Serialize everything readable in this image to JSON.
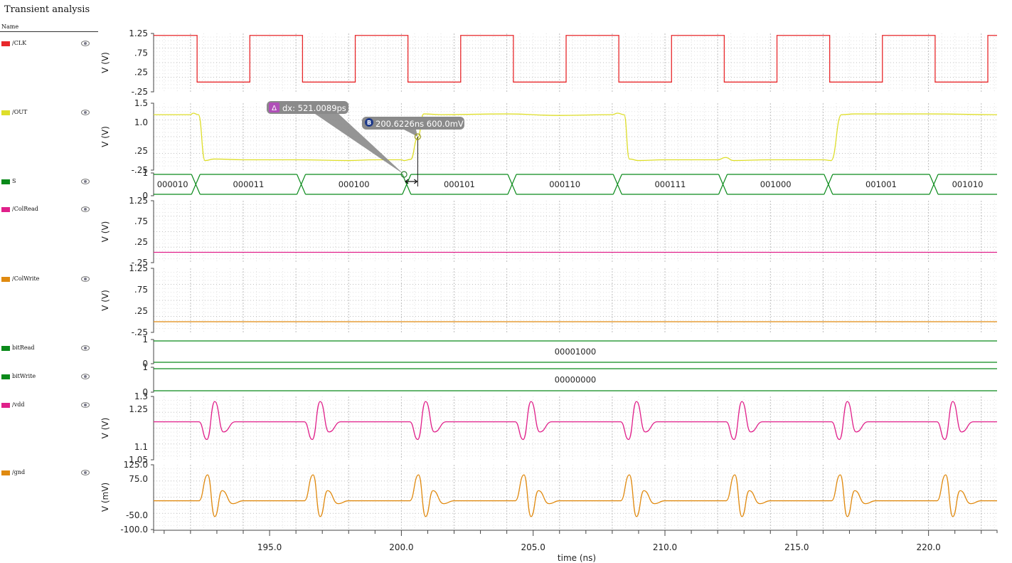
{
  "window": {
    "title": "Transient analysis"
  },
  "legend": {
    "header": "Name",
    "signals": [
      {
        "label": "/CLK",
        "color": "#e8282b",
        "icon": "eye-icon"
      },
      {
        "label": "/OUT",
        "color": "#dede2a",
        "icon": "eye-icon"
      },
      {
        "label": "S",
        "color": "#0a8a1a",
        "icon": "eye-icon"
      },
      {
        "label": "/ColRead",
        "color": "#e0208a",
        "icon": "eye-icon"
      },
      {
        "label": "/ColWrite",
        "color": "#e08a10",
        "icon": "eye-icon"
      },
      {
        "label": "bitRead",
        "color": "#0a8a1a",
        "icon": "eye-icon"
      },
      {
        "label": "bitWrite",
        "color": "#0a8a1a",
        "icon": "eye-icon"
      },
      {
        "label": "/vdd",
        "color": "#e0208a",
        "icon": "eye-icon"
      },
      {
        "label": "/gnd",
        "color": "#e08a10",
        "icon": "eye-icon"
      }
    ]
  },
  "markers": {
    "delta": {
      "icon": "delta-icon",
      "text": "dx: 521.0089ps"
    },
    "b": {
      "icon": "b-marker-icon",
      "text": "200.6226ns 600.0mV"
    }
  },
  "colors": {
    "grid_major": "#bdbdbd",
    "grid_minor": "#e2e2e2",
    "axis": "#333333",
    "callout": "#8a8a8a"
  },
  "chart_data": {
    "type": "line",
    "xlabel": "time (ns)",
    "xlim": [
      190.6,
      222.6
    ],
    "xticks": [
      195.0,
      200.0,
      205.0,
      210.0,
      215.0,
      220.0
    ],
    "xtick_labels": [
      "195.0",
      "200.0",
      "205.0",
      "210.0",
      "215.0",
      "220.0"
    ],
    "panels": [
      {
        "name": "/CLK",
        "kind": "analog",
        "ylabel": "V (V)",
        "ylim": [
          -0.25,
          1.25
        ],
        "yticks": [
          1.25,
          0.75,
          0.25,
          -0.25
        ],
        "ytick_labels": [
          "1.25",
          ".75",
          ".25",
          "-.25"
        ],
        "digital": {
          "t0": 192.25,
          "half_period": 2.0,
          "start_high": false,
          "high": 1.2,
          "low": 0.0,
          "initial": 1.2
        }
      },
      {
        "name": "/OUT",
        "kind": "analog",
        "ylabel": "V (V)",
        "ylim": [
          -0.25,
          1.5
        ],
        "yticks": [
          1.5,
          1.0,
          0.25,
          -0.25
        ],
        "ytick_labels": [
          "1.5",
          "1.0",
          ".25",
          "-.25"
        ],
        "points": [
          [
            190.6,
            1.2
          ],
          [
            192.0,
            1.2
          ],
          [
            192.1,
            1.24
          ],
          [
            192.3,
            1.2
          ],
          [
            192.55,
            0.0
          ],
          [
            192.9,
            0.04
          ],
          [
            194.0,
            0.02
          ],
          [
            196.0,
            0.02
          ],
          [
            198.0,
            0.0
          ],
          [
            199.0,
            0.02
          ],
          [
            200.0,
            0.02
          ],
          [
            200.1,
            0.0
          ],
          [
            200.35,
            0.03
          ],
          [
            200.62,
            0.6
          ],
          [
            200.85,
            1.22
          ],
          [
            201.5,
            1.2
          ],
          [
            204.0,
            1.22
          ],
          [
            206.0,
            1.18
          ],
          [
            208.0,
            1.2
          ],
          [
            208.2,
            1.24
          ],
          [
            208.45,
            1.2
          ],
          [
            208.65,
            0.04
          ],
          [
            209.0,
            0.0
          ],
          [
            210.0,
            0.02
          ],
          [
            212.0,
            0.02
          ],
          [
            212.3,
            0.08
          ],
          [
            212.6,
            0.0
          ],
          [
            214.0,
            0.02
          ],
          [
            216.0,
            0.02
          ],
          [
            216.3,
            0.0
          ],
          [
            216.7,
            1.2
          ],
          [
            217.2,
            1.22
          ],
          [
            220.0,
            1.22
          ],
          [
            222.6,
            1.2
          ]
        ]
      },
      {
        "name": "S",
        "kind": "bus",
        "ylim": [
          0,
          1
        ],
        "yticks": [
          1,
          0
        ],
        "ytick_labels": [
          "1",
          "0"
        ],
        "transitions": [
          192.2,
          196.2,
          200.2,
          204.2,
          208.2,
          212.2,
          216.2,
          220.2
        ],
        "values": [
          "000010",
          "000011",
          "000100",
          "000101",
          "000110",
          "000111",
          "001000",
          "001001",
          "001010"
        ]
      },
      {
        "name": "/ColRead",
        "kind": "analog",
        "ylabel": "V (V)",
        "ylim": [
          -0.25,
          1.25
        ],
        "yticks": [
          1.25,
          0.75,
          0.25,
          -0.25
        ],
        "ytick_labels": [
          "1.25",
          ".75",
          ".25",
          "-.25"
        ],
        "points": [
          [
            190.6,
            0.0
          ],
          [
            222.6,
            0.0
          ]
        ]
      },
      {
        "name": "/ColWrite",
        "kind": "analog",
        "ylabel": "V (V)",
        "ylim": [
          -0.25,
          1.25
        ],
        "yticks": [
          1.25,
          0.75,
          0.25,
          -0.25
        ],
        "ytick_labels": [
          "1.25",
          ".75",
          ".25",
          "-.25"
        ],
        "points": [
          [
            190.6,
            0.0
          ],
          [
            222.6,
            0.0
          ]
        ]
      },
      {
        "name": "bitRead",
        "kind": "bus",
        "ylim": [
          0,
          1
        ],
        "yticks": [
          1,
          0
        ],
        "ytick_labels": [
          "1",
          "0"
        ],
        "transitions": [],
        "values": [
          "00001000"
        ]
      },
      {
        "name": "bitWrite",
        "kind": "bus",
        "ylim": [
          0,
          1
        ],
        "yticks": [
          1,
          0
        ],
        "ytick_labels": [
          "1",
          "0"
        ],
        "transitions": [],
        "values": [
          "00000000"
        ]
      },
      {
        "name": "/vdd",
        "kind": "analog",
        "ylabel": "V (V)",
        "ylim": [
          1.05,
          1.3
        ],
        "yticks": [
          1.3,
          1.25,
          1.1,
          1.05
        ],
        "ytick_labels": [
          "1.3",
          "1.25",
          "1.1",
          "1.05"
        ],
        "baseline": 1.2,
        "glitch": {
          "first": 192.2,
          "period": 4.0,
          "offsets": [
            0.12,
            0.42,
            0.72,
            1.05,
            1.5
          ],
          "values": [
            1.2,
            1.13,
            1.28,
            1.16,
            1.2
          ]
        }
      },
      {
        "name": "/gnd",
        "kind": "analog",
        "ylabel": "V (mV)",
        "ylim": [
          -100.0,
          125.0
        ],
        "yticks": [
          125.0,
          75.0,
          -50.0,
          -100.0
        ],
        "ytick_labels": [
          "125.0",
          "75.0",
          "-50.0",
          "-100.0"
        ],
        "baseline": 0.0,
        "glitch": {
          "first": 192.2,
          "period": 4.0,
          "offsets": [
            0.12,
            0.45,
            0.72,
            1.0,
            1.4,
            1.8
          ],
          "values": [
            0.0,
            90.0,
            -55.0,
            35.0,
            -10.0,
            0.0
          ]
        }
      }
    ]
  }
}
